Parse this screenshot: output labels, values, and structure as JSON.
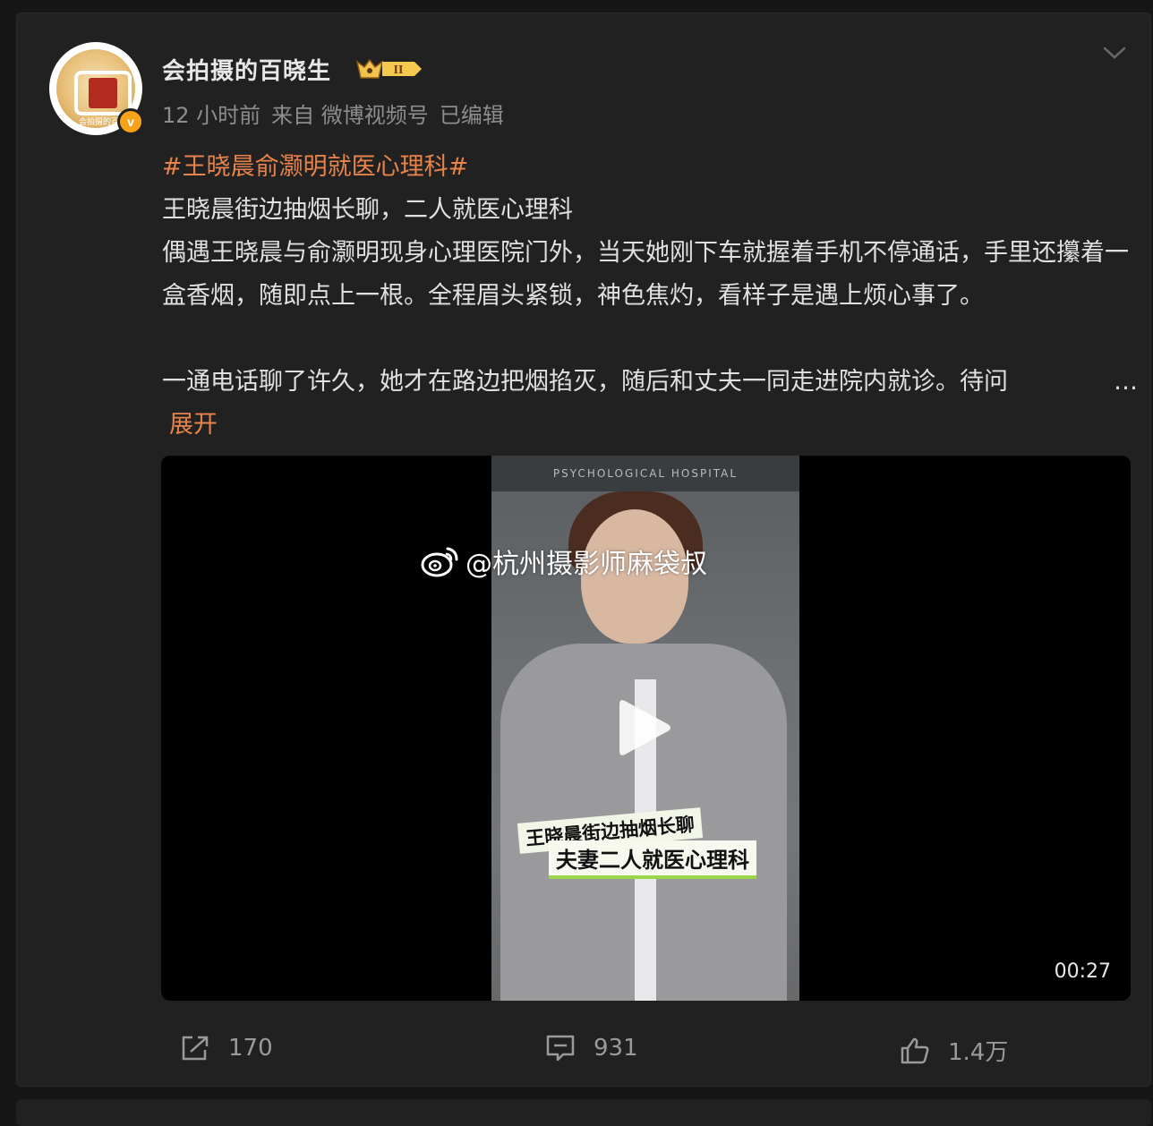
{
  "post": {
    "author": {
      "name": "会拍摄的百晓生",
      "level_badge": "II",
      "verified_mark": "v",
      "avatar_caption": "会拍摄的百晓"
    },
    "meta": {
      "time": "12 小时前",
      "source": "来自 微博视频号",
      "edited": "已编辑"
    },
    "hashtag": "#王晓晨俞灏明就医心理科#",
    "lines": {
      "line1": "王晓晨街边抽烟长聊，二人就医心理科",
      "line2": "偶遇王晓晨与俞灏明现身心理医院门外，当天她刚下车就握着手机不停通话，手里还攥着一盒香烟，随即点上一根。全程眉头紧锁，神色焦灼，看样子是遇上烦心事了。",
      "line3_text": "一通电话聊了许久，她才在路边把烟掐灭，随后和丈夫一同走进院内就诊。待问",
      "line3_ellipsis": "…",
      "expand": "展开"
    },
    "video": {
      "watermark": "@杭州摄影师麻袋叔",
      "caption_top": "王晓晨街边抽烟长聊",
      "caption_bottom": "夫妻二人就医心理科",
      "sign_text": "PSYCHOLOGICAL HOSPITAL",
      "duration": "00:27"
    },
    "actions": {
      "repost_count": "170",
      "comment_count": "931",
      "like_count": "1.4万"
    },
    "icons": {
      "more": "chevron-down-icon",
      "play": "play-icon",
      "repost": "share-icon",
      "comment": "comment-icon",
      "like": "thumbs-up-icon",
      "weibo": "weibo-logo-icon"
    },
    "colors": {
      "accent": "#e8834a",
      "background": "#161616",
      "card": "#212121",
      "badge_gold": "#f6a31a"
    }
  }
}
